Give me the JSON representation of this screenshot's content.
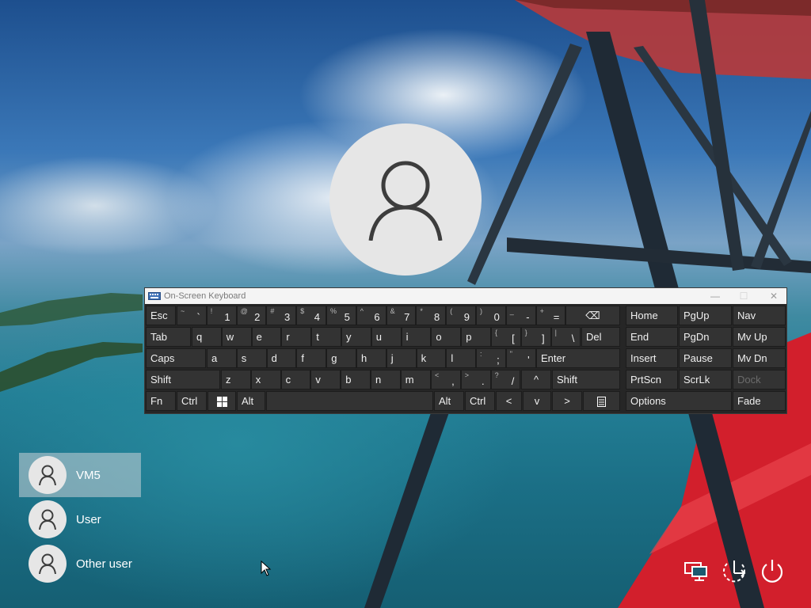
{
  "window": {
    "title": "On-Screen Keyboard",
    "minimize": "—",
    "maximize": "☐",
    "close": "✕"
  },
  "keys": {
    "esc": "Esc",
    "backspace_icon": "⌫",
    "tab": "Tab",
    "del": "Del",
    "caps": "Caps",
    "enter": "Enter",
    "shift_left": "Shift",
    "shift_right": "Shift",
    "fn": "Fn",
    "ctrl_left": "Ctrl",
    "alt_left": "Alt",
    "alt_right": "Alt",
    "ctrl_right": "Ctrl",
    "up": "^",
    "left": "<",
    "down": "v",
    "right": ">",
    "row0": [
      {
        "shift": "~",
        "char": "`"
      },
      {
        "shift": "!",
        "char": "1"
      },
      {
        "shift": "@",
        "char": "2"
      },
      {
        "shift": "#",
        "char": "3"
      },
      {
        "shift": "$",
        "char": "4"
      },
      {
        "shift": "%",
        "char": "5"
      },
      {
        "shift": "^",
        "char": "6"
      },
      {
        "shift": "&",
        "char": "7"
      },
      {
        "shift": "*",
        "char": "8"
      },
      {
        "shift": "(",
        "char": "9"
      },
      {
        "shift": ")",
        "char": "0"
      },
      {
        "shift": "_",
        "char": "-"
      },
      {
        "shift": "+",
        "char": "="
      }
    ],
    "row1": [
      "q",
      "w",
      "e",
      "r",
      "t",
      "y",
      "u",
      "i",
      "o",
      "p"
    ],
    "row1_sym": [
      {
        "shift": "{",
        "char": "["
      },
      {
        "shift": "}",
        "char": "]"
      },
      {
        "shift": "|",
        "char": "\\"
      }
    ],
    "row2": [
      "a",
      "s",
      "d",
      "f",
      "g",
      "h",
      "j",
      "k",
      "l"
    ],
    "row2_sym": [
      {
        "shift": ":",
        "char": ";"
      },
      {
        "shift": "\"",
        "char": "'"
      }
    ],
    "row3": [
      "z",
      "x",
      "c",
      "v",
      "b",
      "n",
      "m"
    ],
    "row3_sym": [
      {
        "shift": "<",
        "char": ","
      },
      {
        "shift": ">",
        "char": "."
      },
      {
        "shift": "?",
        "char": "/"
      }
    ],
    "nav": {
      "home": "Home",
      "pgup": "PgUp",
      "nav": "Nav",
      "end": "End",
      "pgdn": "PgDn",
      "mvup": "Mv Up",
      "insert": "Insert",
      "pause": "Pause",
      "mvdn": "Mv Dn",
      "prtscn": "PrtScn",
      "scrlk": "ScrLk",
      "dock": "Dock",
      "options": "Options",
      "fade": "Fade"
    }
  },
  "users": [
    {
      "name": "VM5",
      "selected": true
    },
    {
      "name": "User",
      "selected": false
    },
    {
      "name": "Other user",
      "selected": false
    }
  ],
  "system_buttons": [
    "network-icon",
    "accessibility-icon",
    "power-icon"
  ]
}
